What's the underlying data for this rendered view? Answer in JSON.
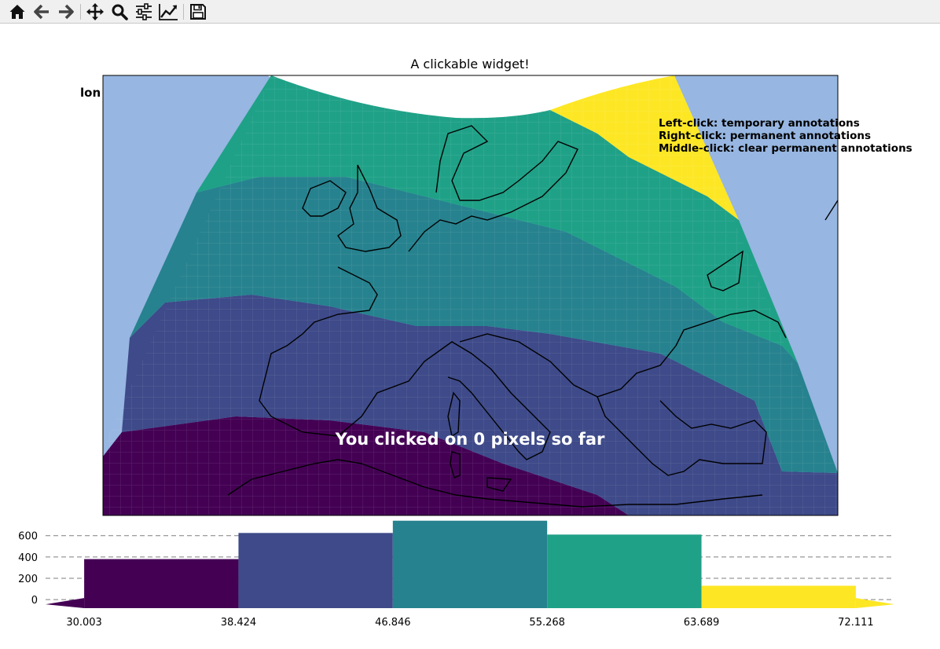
{
  "toolbar": {
    "buttons": [
      {
        "name": "home-button",
        "icon": "home-icon"
      },
      {
        "name": "back-button",
        "icon": "arrow-left-icon"
      },
      {
        "name": "forward-button",
        "icon": "arrow-right-icon"
      },
      {
        "name": "pan-button",
        "icon": "move-icon"
      },
      {
        "name": "zoom-button",
        "icon": "magnifier-icon"
      },
      {
        "name": "configure-subplots-button",
        "icon": "sliders-icon"
      },
      {
        "name": "edit-axis-button",
        "icon": "line-chart-icon"
      },
      {
        "name": "save-button",
        "icon": "floppy-disk-icon"
      }
    ]
  },
  "map": {
    "title": "A clickable widget!",
    "coord_readout": "lon    /    lat",
    "instructions": [
      "Left-click: temporary annotations",
      "Right-click: permanent annotations",
      "Middle-click: clear permanent annotations"
    ],
    "click_message": "You clicked on 0 pixels so far",
    "colors": {
      "ocean": "#97b6e1",
      "band_colors": [
        "#440154",
        "#3e4a89",
        "#26828e",
        "#1fa187",
        "#fde725"
      ]
    }
  },
  "chart_data": {
    "type": "bar",
    "bin_edges": [
      30.003,
      38.424,
      46.846,
      55.268,
      63.689,
      72.111
    ],
    "values": [
      380,
      625,
      740,
      610,
      130
    ],
    "colors": [
      "#440154",
      "#3e4a89",
      "#26828e",
      "#1fa187",
      "#fde725"
    ],
    "yticks": [
      0,
      200,
      400,
      600
    ],
    "xticks": [
      "30.003",
      "38.424",
      "46.846",
      "55.268",
      "63.689",
      "72.111"
    ],
    "ylim": [
      -80,
      760
    ],
    "grid": "horizontal dashed"
  }
}
